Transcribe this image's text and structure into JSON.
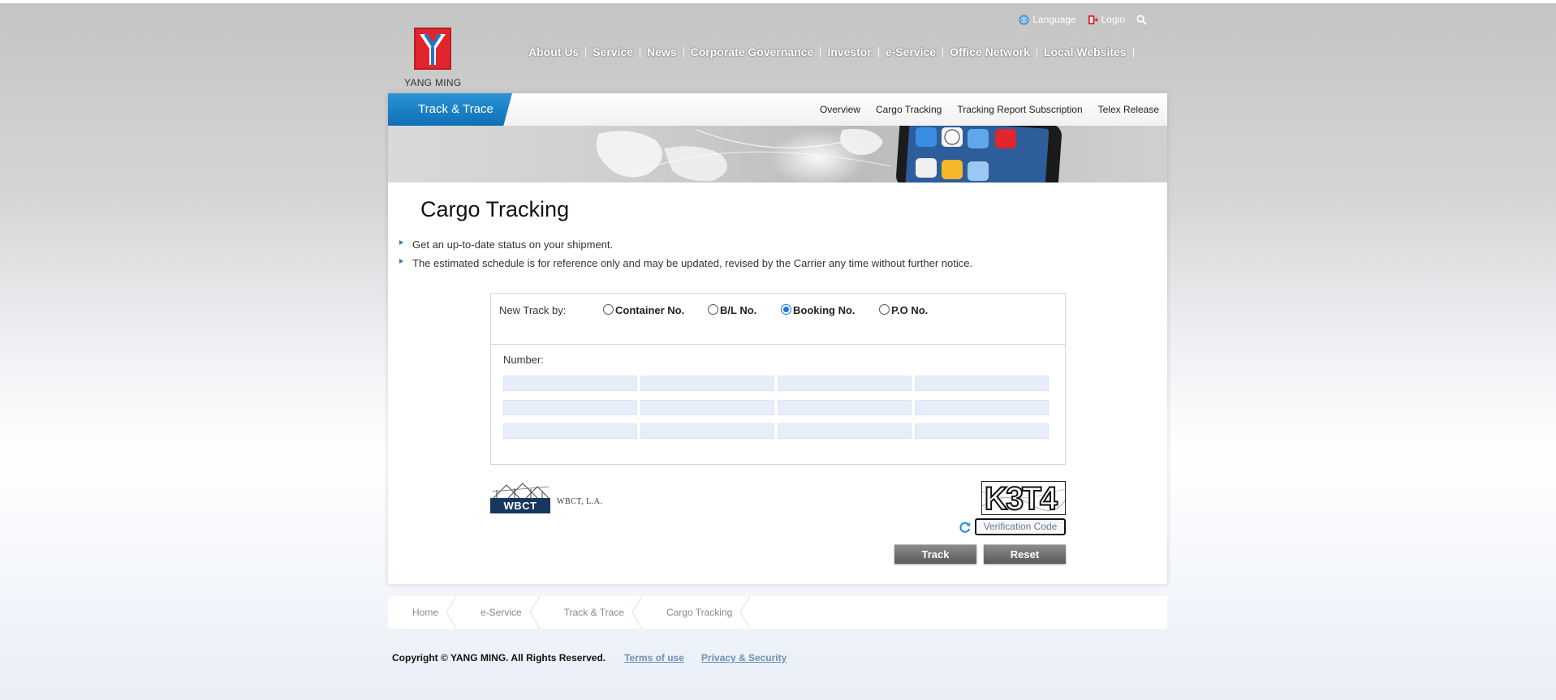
{
  "brand": {
    "name": "YANG MING",
    "accent": "#e0262c",
    "primary_blue": "#0f6fb6"
  },
  "utility": {
    "language": "Language",
    "language_icon": "globe-icon",
    "login": "Login",
    "login_icon": "door-icon",
    "search_icon": "search-icon"
  },
  "nav": [
    "About Us",
    "Service",
    "News",
    "Corporate Governance",
    "Investor",
    "e-Service",
    "Office Network",
    "Local Websites"
  ],
  "subnav": {
    "section": "Track & Trace",
    "links": [
      "Overview",
      "Cargo Tracking",
      "Tracking Report Subscription",
      "Telex Release"
    ]
  },
  "page": {
    "title": "Cargo Tracking",
    "bullets": [
      "Get an up-to-date status on your shipment.",
      "The estimated schedule is for reference only and may be updated, revised by the Carrier any time without further notice."
    ]
  },
  "form": {
    "track_by_label": "New Track by:",
    "options": [
      "Container No.",
      "B/L No.",
      "Booking No.",
      "P.O No."
    ],
    "selected_option": "Booking No.",
    "number_label": "Number:",
    "number_values": [
      "",
      "",
      "",
      "",
      "",
      "",
      "",
      "",
      "",
      "",
      "",
      ""
    ]
  },
  "partner": {
    "logo_text": "WBCT",
    "tagline": "WBCT, L.A."
  },
  "captcha": {
    "image_text": "K3T4",
    "placeholder": "Verification Code",
    "refresh_icon": "refresh-icon"
  },
  "buttons": {
    "track": "Track",
    "reset": "Reset"
  },
  "breadcrumb": [
    "Home",
    "e-Service",
    "Track & Trace",
    "Cargo Tracking"
  ],
  "footer": {
    "copyright": "Copyright © YANG MING. All Rights Reserved.",
    "links": [
      "Terms of use",
      "Privacy & Security"
    ]
  }
}
